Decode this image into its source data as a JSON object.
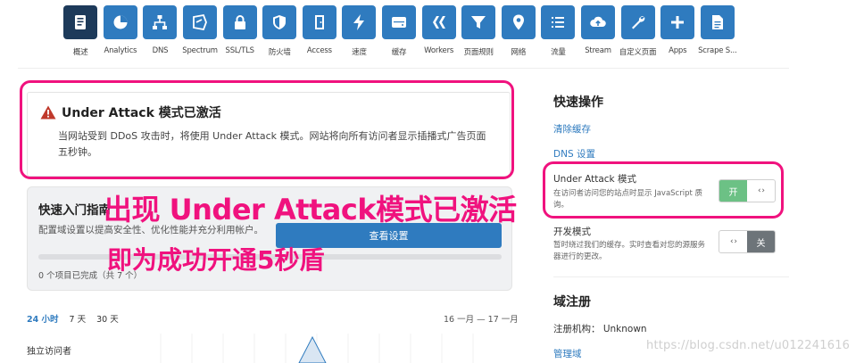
{
  "nav": {
    "items": [
      {
        "label": "概述",
        "icon": "overview-icon"
      },
      {
        "label": "Analytics",
        "icon": "pie-chart-icon"
      },
      {
        "label": "DNS",
        "icon": "network-icon"
      },
      {
        "label": "Spectrum",
        "icon": "shield-speed-icon"
      },
      {
        "label": "SSL/TLS",
        "icon": "lock-icon"
      },
      {
        "label": "防火墙",
        "icon": "shield-icon"
      },
      {
        "label": "Access",
        "icon": "door-icon"
      },
      {
        "label": "速度",
        "icon": "lightning-icon"
      },
      {
        "label": "缓存",
        "icon": "drive-icon"
      },
      {
        "label": "Workers",
        "icon": "workers-icon"
      },
      {
        "label": "页面规则",
        "icon": "filter-icon"
      },
      {
        "label": "网络",
        "icon": "location-pin-icon"
      },
      {
        "label": "流量",
        "icon": "list-icon"
      },
      {
        "label": "Stream",
        "icon": "cloud-upload-icon"
      },
      {
        "label": "自定义页面",
        "icon": "wrench-icon"
      },
      {
        "label": "Apps",
        "icon": "plus-icon"
      },
      {
        "label": "Scrape S...",
        "icon": "document-icon"
      }
    ]
  },
  "alert": {
    "title": "Under Attack 模式已激活",
    "body": "当网站受到 DDoS 攻击时，将使用 Under Attack 模式。网站将向所有访问者显示插播式广告页面五秒钟。"
  },
  "quick_start": {
    "title": "快速入门指南",
    "description": "配置域设置以提高安全性、优化性能并充分利用帐户。",
    "button": "查看设置",
    "progress_text": "0 个项目已完成（共 7 个）",
    "progress": 0
  },
  "overlay": {
    "line1": "出现 Under Attack模式已激活",
    "line2": "即为成功开通5秒盾"
  },
  "analytics": {
    "ranges": [
      "24 小时",
      "7 天",
      "30 天"
    ],
    "selected_range": "24 小时",
    "date_range": "16 一月 — 17 一月",
    "visitors_label": "独立访问者"
  },
  "sidebar": {
    "quick_actions_title": "快速操作",
    "purge_cache": "清除缓存",
    "dns_settings": "DNS 设置",
    "under_attack": {
      "title": "Under Attack 模式",
      "description": "在访问者访问您的站点时显示 JavaScript 质询。",
      "state_label": "开"
    },
    "dev_mode": {
      "title": "开发模式",
      "description": "暂时绕过我们的缓存。实时查看对您的源服务器进行的更改。",
      "state_label": "关"
    },
    "domain_registration_title": "域注册",
    "registrar": "注册机构： Unknown",
    "manage_domain": "管理域"
  },
  "watermark": "https://blog.csdn.net/u012241616",
  "colors": {
    "accent": "#2f7bbf",
    "active_nav": "#1d3a5a",
    "highlight": "#f0127e",
    "toggle_on": "#6cc185",
    "toggle_off": "#6d7479"
  }
}
